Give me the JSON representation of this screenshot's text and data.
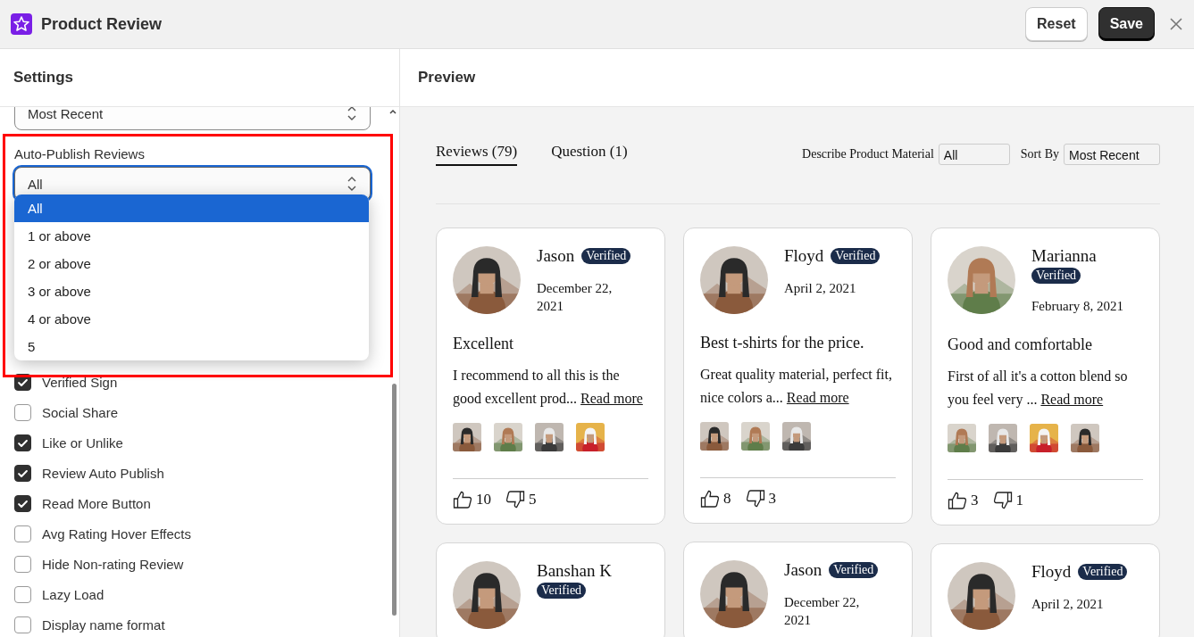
{
  "app": {
    "title": "Product Review"
  },
  "header_buttons": [
    {
      "label": "Reset",
      "kind": "secondary"
    },
    {
      "label": "Save",
      "kind": "primary"
    }
  ],
  "settings": {
    "title": "Settings",
    "sort_select": {
      "value": "Most Recent"
    },
    "auto_publish": {
      "label": "Auto-Publish Reviews",
      "value": "All",
      "expanded": true,
      "options": [
        {
          "label": "All",
          "selected": true
        },
        {
          "label": "1 or above",
          "selected": false
        },
        {
          "label": "2 or above",
          "selected": false
        },
        {
          "label": "3 or above",
          "selected": false
        },
        {
          "label": "4 or above",
          "selected": false
        },
        {
          "label": "5",
          "selected": false
        }
      ]
    },
    "checkboxes": [
      {
        "label": "Verified Sign",
        "checked": true
      },
      {
        "label": "Social Share",
        "checked": false
      },
      {
        "label": "Like or Unlike",
        "checked": true
      },
      {
        "label": "Review Auto Publish",
        "checked": true
      },
      {
        "label": "Read More Button",
        "checked": true
      },
      {
        "label": "Avg Rating Hover Effects",
        "checked": false
      },
      {
        "label": "Hide Non-rating Review",
        "checked": false
      },
      {
        "label": "Lazy Load",
        "checked": false
      },
      {
        "label": "Display name format",
        "checked": false
      }
    ]
  },
  "preview": {
    "title": "Preview",
    "tabs": [
      {
        "label": "Reviews (79)",
        "selected": true
      },
      {
        "label": "Question (1)",
        "selected": false
      }
    ],
    "filters": [
      {
        "label": "Describe Product Material",
        "value": "All"
      },
      {
        "label": "Sort By",
        "value": "Most Recent"
      }
    ],
    "columns": [
      [
        {
          "name": "Jason",
          "badge": "Verified",
          "date": "December 22, 2021",
          "title": "Excellent",
          "body": "I recommend to all this is the good excellent prod... ",
          "read_more": "Read more",
          "likes": "10",
          "dislikes": "5"
        },
        {
          "name": "Banshan K",
          "badge": "Verified"
        }
      ],
      [
        {
          "name": "Floyd",
          "badge": "Verified",
          "date": "April 2, 2021",
          "title": "Best t-shirts for the price.",
          "body": "Great quality material, perfect fit, nice colors a... ",
          "read_more": "Read more",
          "likes": "8",
          "dislikes": "3"
        },
        {
          "name": "Jason",
          "badge": "Verified",
          "date": "December 22, 2021"
        }
      ],
      [
        {
          "name": "Marianna",
          "badge": "Verified",
          "date": "February 8, 2021",
          "title": "Good and comfortable",
          "body": "First of all it's a cotton blend so you feel very ... ",
          "read_more": "Read more",
          "likes": "3",
          "dislikes": "1"
        },
        {
          "name": "Floyd",
          "badge": "Verified",
          "date": "April 2, 2021"
        }
      ]
    ]
  }
}
